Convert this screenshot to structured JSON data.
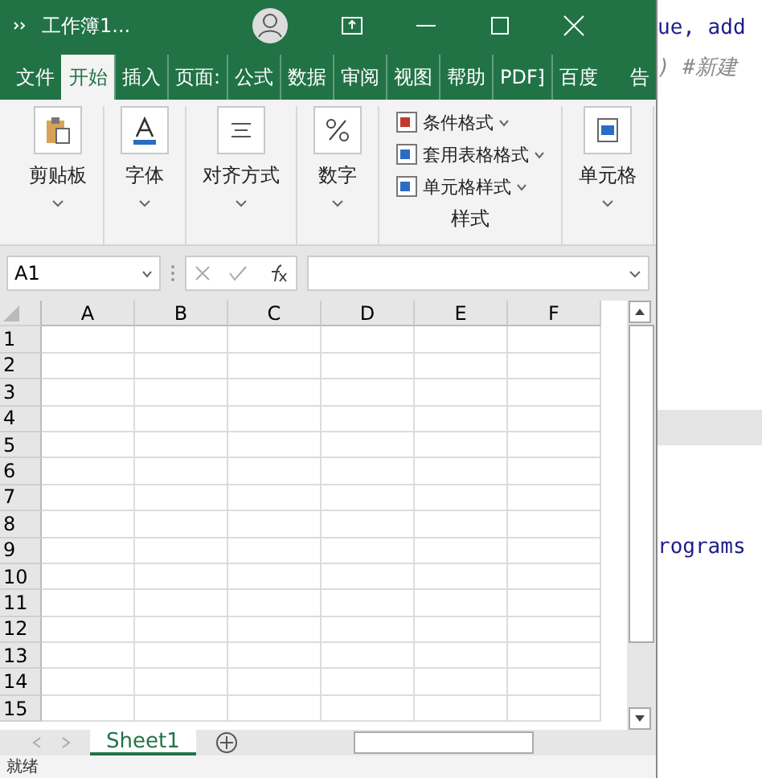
{
  "window": {
    "title": "工作簿1..."
  },
  "ribbon_tabs": [
    {
      "label": "文件",
      "selected": false
    },
    {
      "label": "开始",
      "selected": true
    },
    {
      "label": "插入",
      "selected": false
    },
    {
      "label": "页面:",
      "selected": false
    },
    {
      "label": "公式",
      "selected": false
    },
    {
      "label": "数据",
      "selected": false
    },
    {
      "label": "审阅",
      "selected": false
    },
    {
      "label": "视图",
      "selected": false
    },
    {
      "label": "帮助",
      "selected": false
    },
    {
      "label": "PDF⁆",
      "selected": false
    },
    {
      "label": "百度",
      "selected": false
    },
    {
      "label": "告",
      "selected": false
    }
  ],
  "ribbon_groups": [
    {
      "kind": "big",
      "label": "剪贴板"
    },
    {
      "kind": "big",
      "label": "字体"
    },
    {
      "kind": "big",
      "label": "对齐方式"
    },
    {
      "kind": "big",
      "label": "数字"
    },
    {
      "kind": "list",
      "label": "样式",
      "items": [
        "条件格式",
        "套用表格格式",
        "单元格样式"
      ]
    },
    {
      "kind": "big",
      "label": "单元格"
    }
  ],
  "name_box": {
    "value": "A1"
  },
  "columns": [
    "A",
    "B",
    "C",
    "D",
    "E",
    "F"
  ],
  "rows": [
    "1",
    "2",
    "3",
    "4",
    "5",
    "6",
    "7",
    "8",
    "9",
    "10",
    "11",
    "12",
    "13",
    "14",
    "15"
  ],
  "sheet_tabs": [
    {
      "label": "Sheet1",
      "selected": true
    }
  ],
  "status_bar": {
    "text": "就绪"
  },
  "background_code": [
    {
      "text": "ue, add",
      "kind": "code"
    },
    {
      "text": ") #新建",
      "kind": "comment"
    },
    {
      "text": "rograms",
      "kind": "code"
    }
  ]
}
